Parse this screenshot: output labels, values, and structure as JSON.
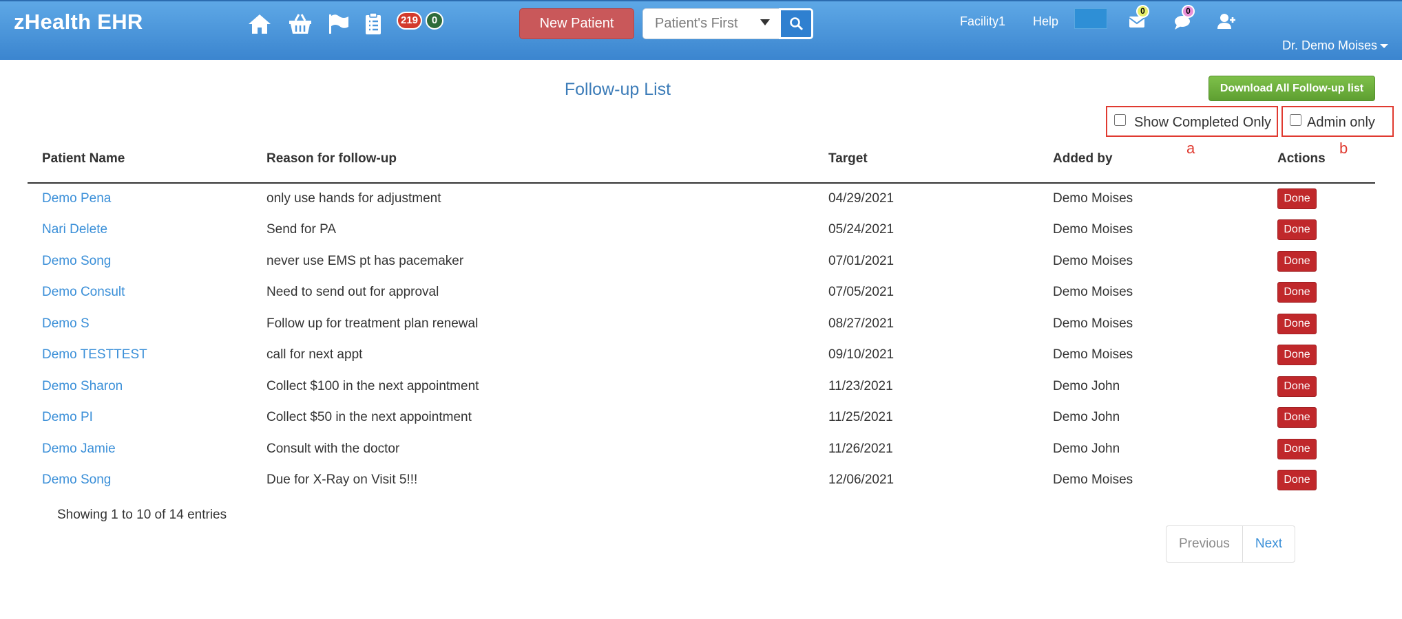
{
  "app": {
    "brand": "zHealth EHR"
  },
  "navbar": {
    "icons": [
      "home-icon",
      "basket-icon",
      "flag-icon",
      "clipboard-icon"
    ],
    "badge_red": "219",
    "badge_green": "0",
    "new_patient_label": "New Patient",
    "search_placeholder": "Patient's First",
    "facility_label": "Facility1",
    "help_label": "Help",
    "mail_count": "0",
    "chat_count": "0",
    "user_name": "Dr. Demo Moises",
    "colors": {
      "bar": "#4a96dc",
      "new_patient": "#c9585a",
      "badge_red": "#d33a2c",
      "badge_green": "#2e6b3a"
    }
  },
  "page": {
    "title": "Follow-up List",
    "download_label": "Download All Follow-up list",
    "show_completed_label": "Show Completed Only",
    "admin_only_label": "Admin only",
    "annotation_a": "a",
    "annotation_b": "b"
  },
  "table": {
    "headers": [
      "Patient Name",
      "Reason for follow-up",
      "Target",
      "Added by",
      "Actions"
    ],
    "rows": [
      {
        "name": "Demo Pena",
        "reason": "only use hands for adjustment",
        "target": "04/29/2021",
        "added_by": "Demo Moises",
        "action": "Done"
      },
      {
        "name": "Nari Delete",
        "reason": "Send for PA",
        "target": "05/24/2021",
        "added_by": "Demo Moises",
        "action": "Done"
      },
      {
        "name": "Demo Song",
        "reason": "never use EMS pt has pacemaker",
        "target": "07/01/2021",
        "added_by": "Demo Moises",
        "action": "Done"
      },
      {
        "name": "Demo Consult",
        "reason": "Need to send out for approval",
        "target": "07/05/2021",
        "added_by": "Demo Moises",
        "action": "Done"
      },
      {
        "name": "Demo S",
        "reason": "Follow up for treatment plan renewal",
        "target": "08/27/2021",
        "added_by": "Demo Moises",
        "action": "Done"
      },
      {
        "name": "Demo TESTTEST",
        "reason": "call for next appt",
        "target": "09/10/2021",
        "added_by": "Demo Moises",
        "action": "Done"
      },
      {
        "name": "Demo Sharon",
        "reason": "Collect $100 in the next appointment",
        "target": "11/23/2021",
        "added_by": "Demo John",
        "action": "Done"
      },
      {
        "name": "Demo PI",
        "reason": "Collect $50 in the next appointment",
        "target": "11/25/2021",
        "added_by": "Demo John",
        "action": "Done"
      },
      {
        "name": "Demo Jamie",
        "reason": "Consult with the doctor",
        "target": "11/26/2021",
        "added_by": "Demo John",
        "action": "Done"
      },
      {
        "name": "Demo Song",
        "reason": "Due for X-Ray on Visit 5!!!",
        "target": "12/06/2021",
        "added_by": "Demo Moises",
        "action": "Done"
      }
    ]
  },
  "footer": {
    "info": "Showing 1 to 10 of 14 entries",
    "previous_label": "Previous",
    "next_label": "Next"
  }
}
